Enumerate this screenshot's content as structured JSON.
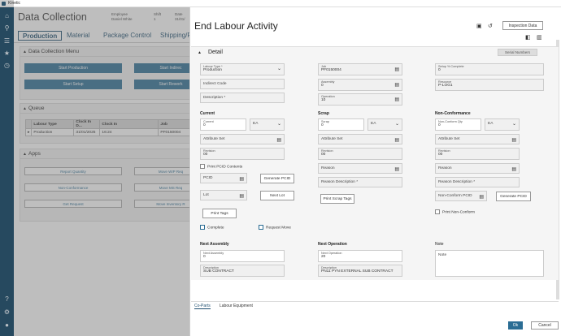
{
  "app": {
    "title": "Kinetic"
  },
  "background": {
    "title": "Data Collection",
    "employee_label": "Employee",
    "employee_value": "Daniel White",
    "shift_label": "Shift",
    "shift_value": "1",
    "date_label": "Date",
    "date_value": "31/01/",
    "tabs": [
      "Production",
      "Material",
      "Package Control",
      "Shipping/R"
    ],
    "menu_title": "Data Collection Menu",
    "menu_buttons": [
      "Start Production",
      "Start Indirec",
      "Start Setup",
      "Start Rework"
    ],
    "queue_title": "Queue",
    "queue_columns": [
      "Labour Type",
      "Clock In D...",
      "Clock In",
      "Job"
    ],
    "queue_rows": [
      [
        "Production",
        "31/01/2025",
        "16:24",
        "PF0150004"
      ]
    ],
    "apps_title": "Apps",
    "apps_buttons": [
      "Report Quantity",
      "Move WIP Req",
      "Non-Conformance",
      "Move MS Req",
      "Get Request",
      "Move Inventory R"
    ]
  },
  "panel": {
    "title": "End Labour Activity",
    "inspection_button": "Inspection Data",
    "detail_title": "Detail",
    "serial_button": "Serial Numbers",
    "fields": {
      "labour_type_label": "Labour Type *",
      "labour_type_value": "Production",
      "indirect_code": "Indirect Code",
      "description": "Description *",
      "job_label": "Job",
      "job_value": "PF0150004",
      "assembly_label": "Assembly",
      "assembly_value": "0",
      "operation_label": "Operation",
      "operation_value": "10",
      "setup_label": "Setup % Complete",
      "setup_value": "0",
      "resource_label": "Resource",
      "resource_value": "P-LOG1"
    },
    "current": {
      "heading": "Current",
      "qty_label": "Current",
      "qty_value": "0",
      "uom": "EA",
      "attribute_set": "Attribute Set",
      "revision_label": "Revision",
      "revision_value": "00",
      "print_pcid": "Print PCID Contents",
      "pcid": "PCID",
      "generate_pcid": "Generate PCID",
      "lot": "Lot",
      "next_lot": "Next Lot",
      "print_tags": "Print Tags",
      "complete": "Complete",
      "request_move": "Request Move"
    },
    "scrap": {
      "heading": "Scrap",
      "qty_label": "Scrap",
      "qty_value": "0",
      "uom": "EA",
      "attribute_set": "Attribute Set",
      "revision_label": "Revision",
      "revision_value": "00",
      "reason": "Reason",
      "reason_desc": "Reason Description *",
      "print_scrap_tags": "Print Scrap Tags"
    },
    "nonconf": {
      "heading": "Non-Conformance",
      "qty_label": "Non-Conform Qty",
      "qty_value": "0",
      "uom": "EA",
      "attribute_set": "Attribute Set",
      "revision_label": "Revision",
      "revision_value": "00",
      "reason": "Reason",
      "reason_desc": "Reason Description *",
      "pcid": "Non-Conform PCID",
      "generate_pcid": "Generate PCID",
      "print_nonconf": "Print Non-Conform"
    },
    "next_assembly": {
      "heading": "Next Assembly",
      "label": "Next Assembly",
      "value": "0",
      "desc_label": "Description",
      "desc_value": "SUB CONTRACT"
    },
    "next_operation": {
      "heading": "Next Operation",
      "label": "Next Operation",
      "value": "20",
      "desc_label": "Description",
      "desc_value": "PN11 PYN EXTERNAL SUB CONTRACT"
    },
    "note": {
      "heading": "Note",
      "placeholder": "Note"
    },
    "bottom_tabs": [
      "Co-Parts",
      "Labour Equipment"
    ],
    "ok": "Ok",
    "cancel": "Cancel"
  },
  "colors": {
    "nav": "#1f4e6b",
    "accent": "#2b6d94"
  }
}
